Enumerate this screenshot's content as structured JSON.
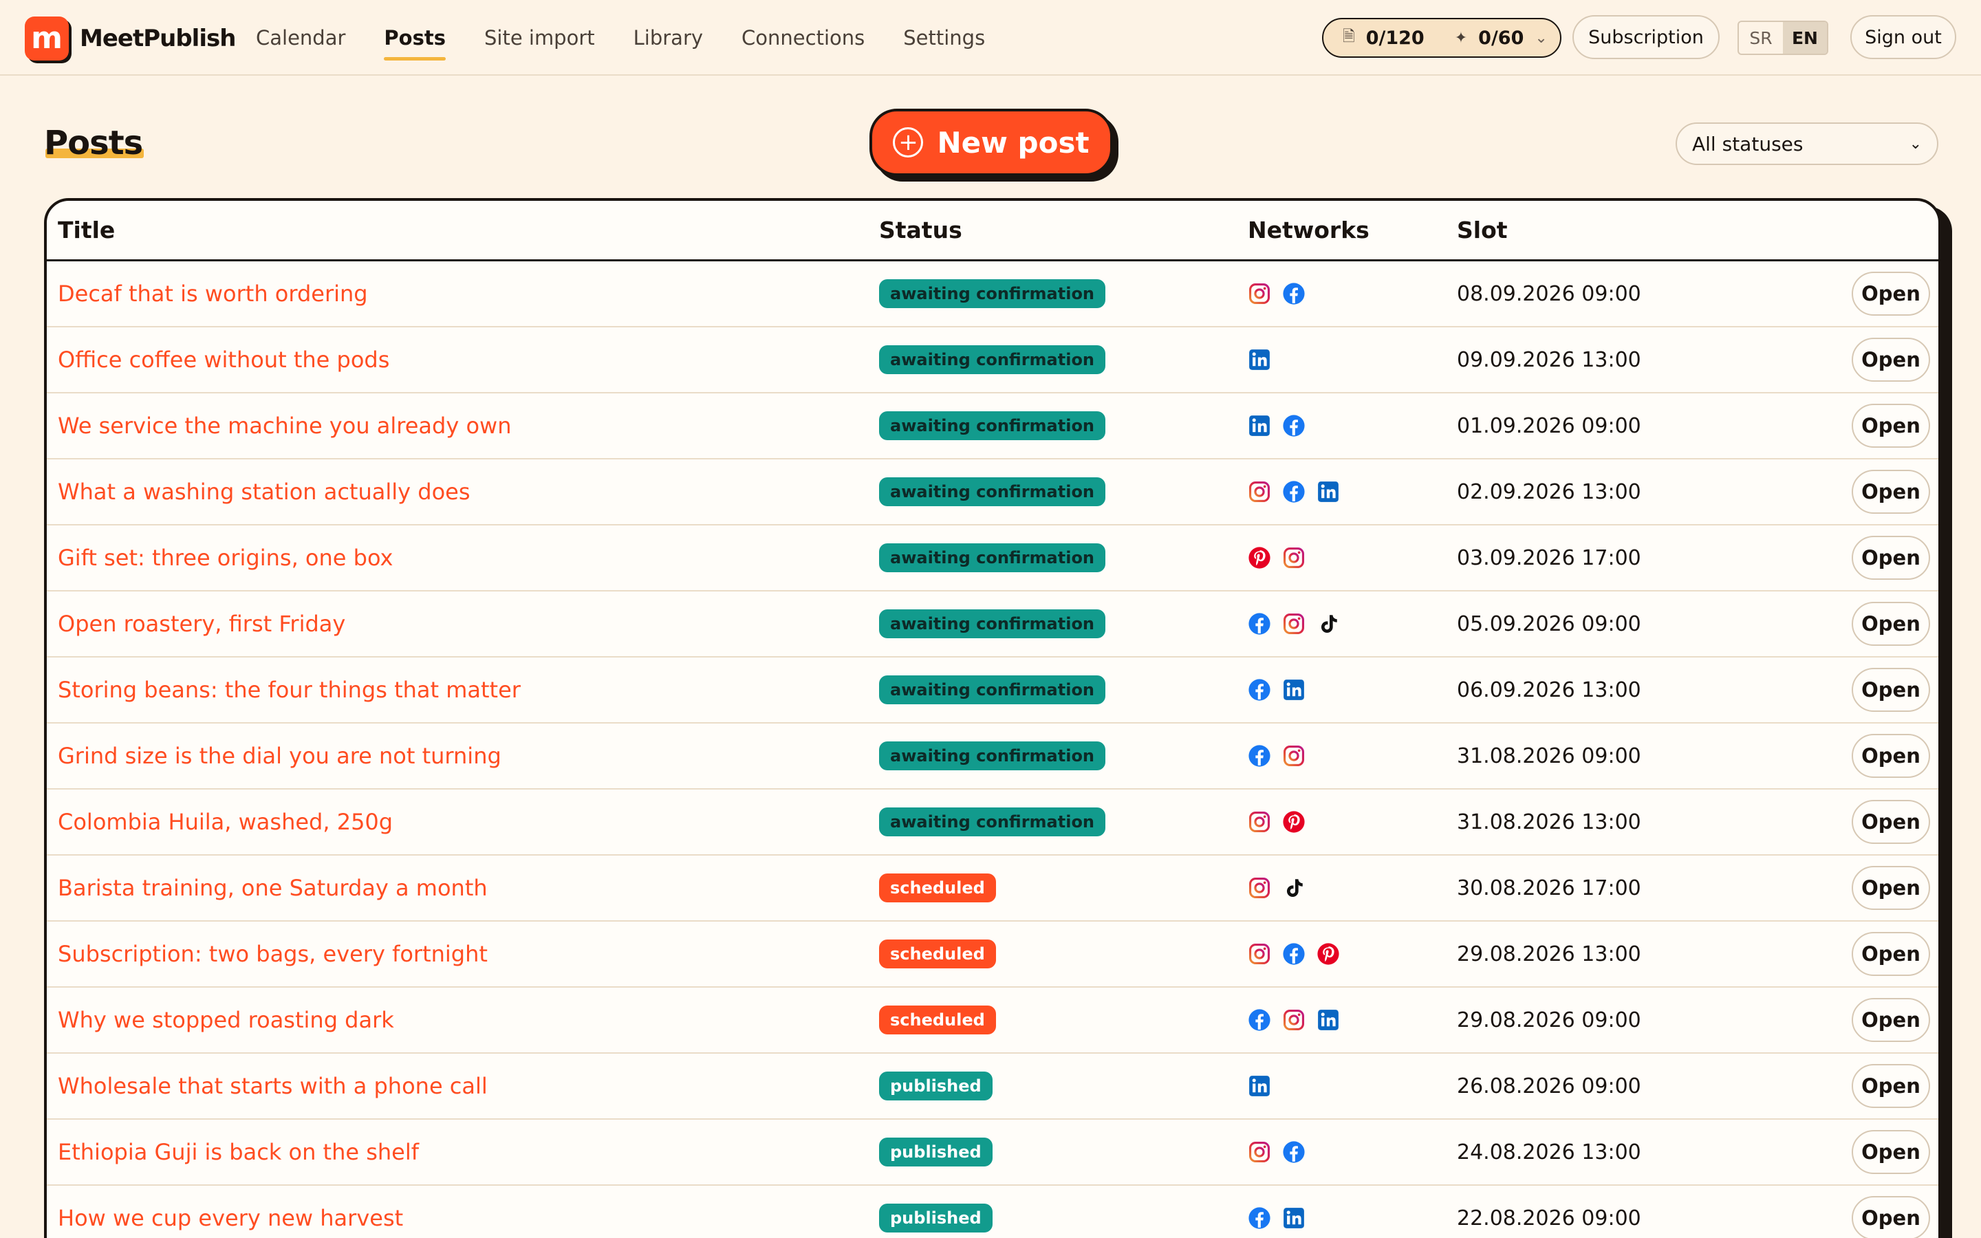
{
  "app": {
    "name": "MeetPublish",
    "logo_letter": "m"
  },
  "nav": {
    "items": [
      {
        "label": "Calendar",
        "active": false
      },
      {
        "label": "Posts",
        "active": true
      },
      {
        "label": "Site import",
        "active": false
      },
      {
        "label": "Library",
        "active": false
      },
      {
        "label": "Connections",
        "active": false
      },
      {
        "label": "Settings",
        "active": false
      }
    ]
  },
  "quota": {
    "posts": "0/120",
    "ai": "0/60"
  },
  "header_actions": {
    "subscription": "Subscription",
    "lang_sr": "SR",
    "lang_en": "EN",
    "active_lang": "EN",
    "sign_out": "Sign out"
  },
  "page": {
    "title": "Posts",
    "new_post_label": "New post",
    "status_filter": "All statuses"
  },
  "table": {
    "columns": {
      "title": "Title",
      "status": "Status",
      "networks": "Networks",
      "slot": "Slot"
    },
    "open_label": "Open",
    "rows": [
      {
        "title": "Decaf that is worth ordering",
        "status": "awaiting confirmation",
        "networks": [
          "instagram",
          "facebook"
        ],
        "slot": "08.09.2026 09:00"
      },
      {
        "title": "Office coffee without the pods",
        "status": "awaiting confirmation",
        "networks": [
          "linkedin"
        ],
        "slot": "09.09.2026 13:00"
      },
      {
        "title": "We service the machine you already own",
        "status": "awaiting confirmation",
        "networks": [
          "linkedin",
          "facebook"
        ],
        "slot": "01.09.2026 09:00"
      },
      {
        "title": "What a washing station actually does",
        "status": "awaiting confirmation",
        "networks": [
          "instagram",
          "facebook",
          "linkedin"
        ],
        "slot": "02.09.2026 13:00"
      },
      {
        "title": "Gift set: three origins, one box",
        "status": "awaiting confirmation",
        "networks": [
          "pinterest",
          "instagram"
        ],
        "slot": "03.09.2026 17:00"
      },
      {
        "title": "Open roastery, first Friday",
        "status": "awaiting confirmation",
        "networks": [
          "facebook",
          "instagram",
          "tiktok"
        ],
        "slot": "05.09.2026 09:00"
      },
      {
        "title": "Storing beans: the four things that matter",
        "status": "awaiting confirmation",
        "networks": [
          "facebook",
          "linkedin"
        ],
        "slot": "06.09.2026 13:00"
      },
      {
        "title": "Grind size is the dial you are not turning",
        "status": "awaiting confirmation",
        "networks": [
          "facebook",
          "instagram"
        ],
        "slot": "31.08.2026 09:00"
      },
      {
        "title": "Colombia Huila, washed, 250g",
        "status": "awaiting confirmation",
        "networks": [
          "instagram",
          "pinterest"
        ],
        "slot": "31.08.2026 13:00"
      },
      {
        "title": "Barista training, one Saturday a month",
        "status": "scheduled",
        "networks": [
          "instagram",
          "tiktok"
        ],
        "slot": "30.08.2026 17:00"
      },
      {
        "title": "Subscription: two bags, every fortnight",
        "status": "scheduled",
        "networks": [
          "instagram",
          "facebook",
          "pinterest"
        ],
        "slot": "29.08.2026 13:00"
      },
      {
        "title": "Why we stopped roasting dark",
        "status": "scheduled",
        "networks": [
          "facebook",
          "instagram",
          "linkedin"
        ],
        "slot": "29.08.2026 09:00"
      },
      {
        "title": "Wholesale that starts with a phone call",
        "status": "published",
        "networks": [
          "linkedin"
        ],
        "slot": "26.08.2026 09:00"
      },
      {
        "title": "Ethiopia Guji is back on the shelf",
        "status": "published",
        "networks": [
          "instagram",
          "facebook"
        ],
        "slot": "24.08.2026 13:00"
      },
      {
        "title": "How we cup every new harvest",
        "status": "published",
        "networks": [
          "facebook",
          "linkedin"
        ],
        "slot": "22.08.2026 09:00"
      }
    ]
  },
  "colors": {
    "accent": "#ff4d21",
    "teal": "#129b8d",
    "background": "#fdf3e6",
    "highlight": "#f4b53d"
  }
}
